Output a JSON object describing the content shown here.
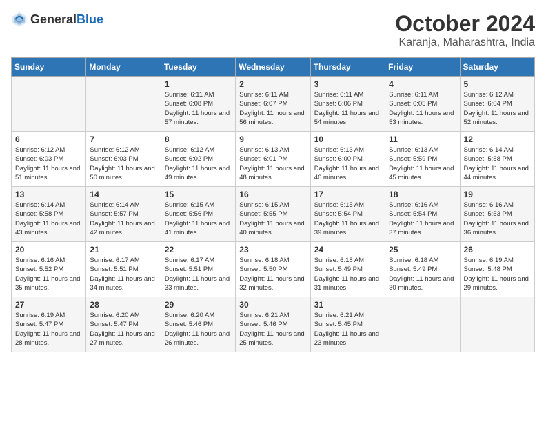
{
  "logo": {
    "general": "General",
    "blue": "Blue"
  },
  "header": {
    "month_year": "October 2024",
    "location": "Karanja, Maharashtra, India"
  },
  "days_of_week": [
    "Sunday",
    "Monday",
    "Tuesday",
    "Wednesday",
    "Thursday",
    "Friday",
    "Saturday"
  ],
  "weeks": [
    [
      {
        "day": "",
        "info": ""
      },
      {
        "day": "",
        "info": ""
      },
      {
        "day": "1",
        "info": "Sunrise: 6:11 AM\nSunset: 6:08 PM\nDaylight: 11 hours and 57 minutes."
      },
      {
        "day": "2",
        "info": "Sunrise: 6:11 AM\nSunset: 6:07 PM\nDaylight: 11 hours and 56 minutes."
      },
      {
        "day": "3",
        "info": "Sunrise: 6:11 AM\nSunset: 6:06 PM\nDaylight: 11 hours and 54 minutes."
      },
      {
        "day": "4",
        "info": "Sunrise: 6:11 AM\nSunset: 6:05 PM\nDaylight: 11 hours and 53 minutes."
      },
      {
        "day": "5",
        "info": "Sunrise: 6:12 AM\nSunset: 6:04 PM\nDaylight: 11 hours and 52 minutes."
      }
    ],
    [
      {
        "day": "6",
        "info": "Sunrise: 6:12 AM\nSunset: 6:03 PM\nDaylight: 11 hours and 51 minutes."
      },
      {
        "day": "7",
        "info": "Sunrise: 6:12 AM\nSunset: 6:03 PM\nDaylight: 11 hours and 50 minutes."
      },
      {
        "day": "8",
        "info": "Sunrise: 6:12 AM\nSunset: 6:02 PM\nDaylight: 11 hours and 49 minutes."
      },
      {
        "day": "9",
        "info": "Sunrise: 6:13 AM\nSunset: 6:01 PM\nDaylight: 11 hours and 48 minutes."
      },
      {
        "day": "10",
        "info": "Sunrise: 6:13 AM\nSunset: 6:00 PM\nDaylight: 11 hours and 46 minutes."
      },
      {
        "day": "11",
        "info": "Sunrise: 6:13 AM\nSunset: 5:59 PM\nDaylight: 11 hours and 45 minutes."
      },
      {
        "day": "12",
        "info": "Sunrise: 6:14 AM\nSunset: 5:58 PM\nDaylight: 11 hours and 44 minutes."
      }
    ],
    [
      {
        "day": "13",
        "info": "Sunrise: 6:14 AM\nSunset: 5:58 PM\nDaylight: 11 hours and 43 minutes."
      },
      {
        "day": "14",
        "info": "Sunrise: 6:14 AM\nSunset: 5:57 PM\nDaylight: 11 hours and 42 minutes."
      },
      {
        "day": "15",
        "info": "Sunrise: 6:15 AM\nSunset: 5:56 PM\nDaylight: 11 hours and 41 minutes."
      },
      {
        "day": "16",
        "info": "Sunrise: 6:15 AM\nSunset: 5:55 PM\nDaylight: 11 hours and 40 minutes."
      },
      {
        "day": "17",
        "info": "Sunrise: 6:15 AM\nSunset: 5:54 PM\nDaylight: 11 hours and 39 minutes."
      },
      {
        "day": "18",
        "info": "Sunrise: 6:16 AM\nSunset: 5:54 PM\nDaylight: 11 hours and 37 minutes."
      },
      {
        "day": "19",
        "info": "Sunrise: 6:16 AM\nSunset: 5:53 PM\nDaylight: 11 hours and 36 minutes."
      }
    ],
    [
      {
        "day": "20",
        "info": "Sunrise: 6:16 AM\nSunset: 5:52 PM\nDaylight: 11 hours and 35 minutes."
      },
      {
        "day": "21",
        "info": "Sunrise: 6:17 AM\nSunset: 5:51 PM\nDaylight: 11 hours and 34 minutes."
      },
      {
        "day": "22",
        "info": "Sunrise: 6:17 AM\nSunset: 5:51 PM\nDaylight: 11 hours and 33 minutes."
      },
      {
        "day": "23",
        "info": "Sunrise: 6:18 AM\nSunset: 5:50 PM\nDaylight: 11 hours and 32 minutes."
      },
      {
        "day": "24",
        "info": "Sunrise: 6:18 AM\nSunset: 5:49 PM\nDaylight: 11 hours and 31 minutes."
      },
      {
        "day": "25",
        "info": "Sunrise: 6:18 AM\nSunset: 5:49 PM\nDaylight: 11 hours and 30 minutes."
      },
      {
        "day": "26",
        "info": "Sunrise: 6:19 AM\nSunset: 5:48 PM\nDaylight: 11 hours and 29 minutes."
      }
    ],
    [
      {
        "day": "27",
        "info": "Sunrise: 6:19 AM\nSunset: 5:47 PM\nDaylight: 11 hours and 28 minutes."
      },
      {
        "day": "28",
        "info": "Sunrise: 6:20 AM\nSunset: 5:47 PM\nDaylight: 11 hours and 27 minutes."
      },
      {
        "day": "29",
        "info": "Sunrise: 6:20 AM\nSunset: 5:46 PM\nDaylight: 11 hours and 26 minutes."
      },
      {
        "day": "30",
        "info": "Sunrise: 6:21 AM\nSunset: 5:46 PM\nDaylight: 11 hours and 25 minutes."
      },
      {
        "day": "31",
        "info": "Sunrise: 6:21 AM\nSunset: 5:45 PM\nDaylight: 11 hours and 23 minutes."
      },
      {
        "day": "",
        "info": ""
      },
      {
        "day": "",
        "info": ""
      }
    ]
  ]
}
